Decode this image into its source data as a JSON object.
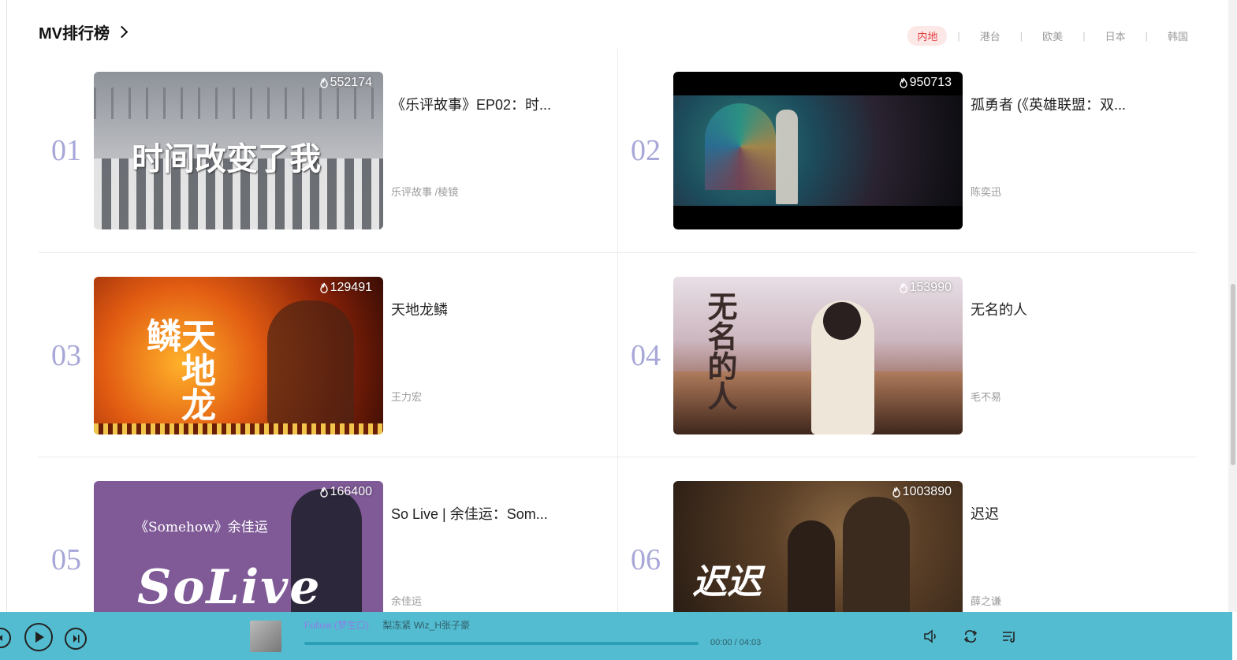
{
  "header": {
    "title": "MV排行榜"
  },
  "tabs": [
    {
      "label": "内地",
      "active": true
    },
    {
      "label": "港台",
      "active": false
    },
    {
      "label": "欧美",
      "active": false
    },
    {
      "label": "日本",
      "active": false
    },
    {
      "label": "韩国",
      "active": false
    }
  ],
  "mvs": [
    {
      "rank": "01",
      "views": "552174",
      "title": "《乐评故事》EP02：时...",
      "artist": "乐评故事 /棱镜",
      "overlay": "时间改变了我"
    },
    {
      "rank": "02",
      "views": "950713",
      "title": "孤勇者 (《英雄联盟：双...",
      "artist": "陈奕迅"
    },
    {
      "rank": "03",
      "views": "129491",
      "title": "天地龙鳞",
      "artist": "王力宏",
      "overlay": "天地龙鳞"
    },
    {
      "rank": "04",
      "views": "153990",
      "title": "无名的人",
      "artist": "毛不易",
      "overlay": "无名的人"
    },
    {
      "rank": "05",
      "views": "166400",
      "title": "So Live | 余佳运：Som...",
      "artist": "余佳运",
      "overlay": "《Somehow》余佳运"
    },
    {
      "rank": "06",
      "views": "1003890",
      "title": "迟迟",
      "artist": "薛之谦",
      "overlay": "迟迟"
    }
  ],
  "player": {
    "song": "Follow (梦生口)",
    "artist": "梨冻紧  Wiz_H张子豪",
    "time": "00:00 / 04:03",
    "progress": 0
  },
  "colors": {
    "accent": "#e23b3b",
    "player_bg": "#54bcd0",
    "rank": "#a7a7d8"
  }
}
